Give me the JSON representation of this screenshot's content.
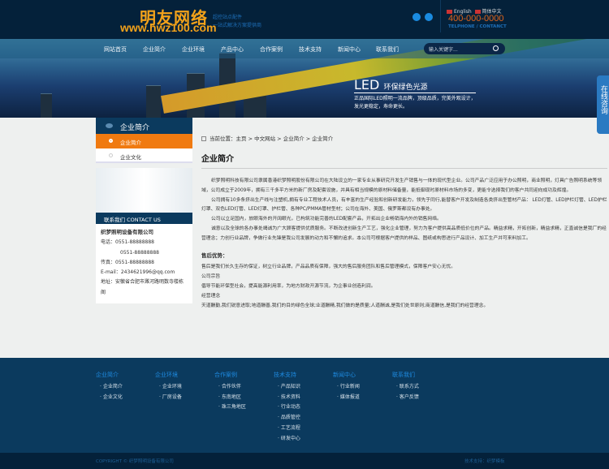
{
  "header": {
    "logo_cn": "明友网络",
    "logo_url": "www.hwz100.com",
    "slogan": [
      "超控站点配件",
      "一站式解决方案提供商"
    ],
    "lang_en": "English",
    "lang_cn": "简体中文",
    "phone": "400-000-0000",
    "phone_label": "TELPHONE / CONTANCT"
  },
  "nav": {
    "items": [
      "网站首页",
      "企业简介",
      "企业环境",
      "产品中心",
      "合作案例",
      "技术支持",
      "新闻中心",
      "联系我们"
    ],
    "search_placeholder": "输入关键字..."
  },
  "banner": {
    "title": "LED",
    "title_sub": "环保绿色光源",
    "line1": "正品国际LED照明一流品牌，顶级品质，完美外观设计，",
    "line2": "发光更稳定，寿命更长。",
    "consult": "在线咨询"
  },
  "sidebar": {
    "title": "企业简介",
    "items": [
      {
        "label": "企业简介",
        "active": true
      },
      {
        "label": "企业文化",
        "active": false
      }
    ]
  },
  "contact": {
    "title": "联系我们",
    "title_en": "CONTACT US",
    "company": "织梦照明设备有限公司",
    "tel_label": "电话：",
    "tel1": "0551-88888888",
    "tel2": "0551-88888888",
    "fax_label": "传真：",
    "fax": "0551-88888888",
    "email_label": "E-mail：",
    "email": "2434621996@qq.com",
    "addr_label": "地址：",
    "addr": "安徽省合肥市濉河路明数寺楼栋阁"
  },
  "breadcrumb": {
    "prefix": "当前位置：",
    "items": [
      "主页",
      "中文网站",
      "企业简介",
      "企业简介"
    ]
  },
  "main": {
    "title": "企业简介",
    "paras": [
      "织梦照明科技有限公司隶属香港织梦照明股份有限公司在大陆设立的一家专业从事研究开发生产销售与一体的现代型企业。公司产品广泛应用于办公照明，商业照明，灯具广告照明系统等领域，公司成立于2009年，拥有三千多平方米的新厂房及配套设施，并具有相当规模的原材料储备量，能抵御现时原材料市场的多变，更能令选择我们的客户共同迎向成功及辉煌。",
      "公司拥有10多条挤出生产线与注塑机,拥有专业工程技术人员，有丰富的生产经验和创新研发能力，领先于同行,能替客户开发及制造各类挤出型管材产品：  LED灯管、LED护栏灯管、LED护栏灯罩、双色LED灯管、LED灯罩、护栏管、各种PC/PMMA管材型材；公司在海外、美国、俄罗斯都设有办事处。",
      "公司以立足国内，放眼海外的开阔眼光，已构筑功能完善的LED配套产品，开拓出企业畅销海内外的销售网络。",
      "诚意以及全球的各办事处竭诚为广大顾客提供优质服务。不断改进创新生产工艺，强化企业管理，努力为客户提供高品质低价位的产品。精益求精，开拓创新，精益求精，正直诚信是我厂的经营理念；力创行业品牌，争做行业先锋是我公司发展的动力和不懈的追求。本公司可根据客户提供的样品、图纸或构思进行产品设计、加工生产并可来料加工。"
    ],
    "after_title": "售后优势：",
    "after_lines": [
      "售后是我们长久生存的保证，树立行业品牌，产品品质有保障，强大的售后服务团队和售后管理模式，保障客户安心无忧。",
      "公司宗旨",
      "倡导节能环保型社会，提高能源利用率，为地方财政开源节流，为企事业创造利润。",
      "经营理念",
      "天道酬勤,我们锐意进取;地道酬善,我们的目的绿色全球;业道酬精,我们做的是质量;人道酬诚,是我们处世原则;商道酬信,是我们的经营理念。"
    ]
  },
  "footer": {
    "cols": [
      {
        "title": "企业简介",
        "items": [
          "企业简介",
          "企业文化"
        ]
      },
      {
        "title": "企业环境",
        "items": [
          "企业环境",
          "厂房设备"
        ]
      },
      {
        "title": "合作案例",
        "items": [
          "合作伙伴",
          "东南地区",
          "珠三角地区"
        ]
      },
      {
        "title": "技术支持",
        "items": [
          "产品知识",
          "技术资料",
          "行业动态",
          "品质管控",
          "工艺流程",
          "研发中心"
        ]
      },
      {
        "title": "新闻中心",
        "items": [
          "行业新闻",
          "媒体报道"
        ]
      },
      {
        "title": "联系我们",
        "items": [
          "联系方式",
          "客户反馈"
        ]
      }
    ],
    "copyright": "COPYRIGHT © 织梦照明设备有限公司",
    "tech": "技术支持：织梦模板"
  },
  "colors": {
    "header": "#04213a",
    "accent": "#f07a10",
    "footer": "#0b3a5e"
  }
}
